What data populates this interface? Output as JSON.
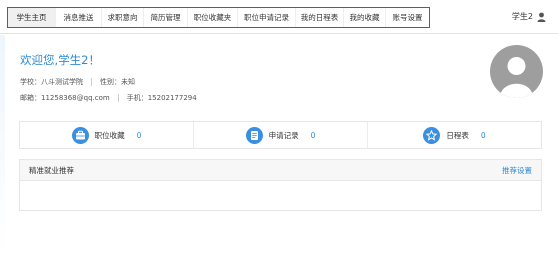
{
  "nav": {
    "items": [
      {
        "label": "学生主页",
        "active": true
      },
      {
        "label": "消息推送",
        "active": false
      },
      {
        "label": "求职意向",
        "active": false
      },
      {
        "label": "简历管理",
        "active": false
      },
      {
        "label": "职位收藏夹",
        "active": false
      },
      {
        "label": "职位申请记录",
        "active": false
      },
      {
        "label": "我的日程表",
        "active": false
      },
      {
        "label": "我的收藏",
        "active": false
      },
      {
        "label": "账号设置",
        "active": false
      }
    ],
    "highlight_color": "#e0252b"
  },
  "user": {
    "name": "学生2",
    "icon": "user-icon"
  },
  "profile": {
    "welcome": "欢迎您,学生2！",
    "school_label": "学校：八斗测试学院",
    "gender_label": "性别：未知",
    "email_label": "邮箱：11258368@qq.com",
    "phone_label": "手机：15202177294",
    "avatar_icon": "avatar-silhouette-icon"
  },
  "stats": [
    {
      "label": "职位收藏",
      "count": "0",
      "icon": "briefcase-icon"
    },
    {
      "label": "申请记录",
      "count": "0",
      "icon": "document-icon"
    },
    {
      "label": "日程表",
      "count": "0",
      "icon": "star-icon"
    }
  ],
  "recommend": {
    "title": "精准就业推荐",
    "settings_link": "推荐设置"
  },
  "colors": {
    "accent": "#2e8bd6",
    "icon_bg": "#3b8fe0",
    "avatar_bg": "#9e9e9e"
  }
}
